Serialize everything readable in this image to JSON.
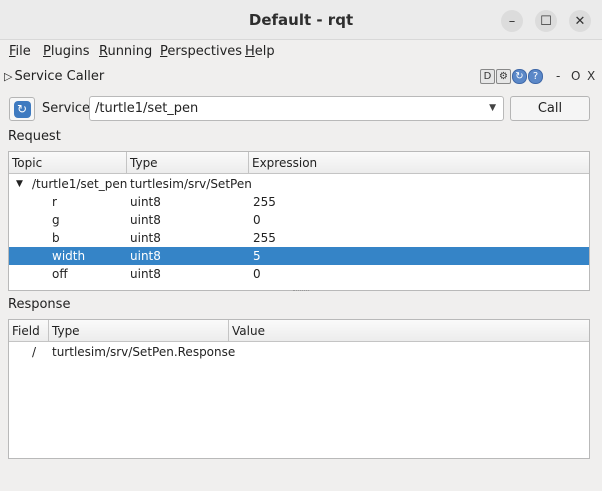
{
  "window": {
    "title": "Default - rqt"
  },
  "menu": [
    {
      "u": "F",
      "rest": "ile"
    },
    {
      "u": "P",
      "rest": "lugins"
    },
    {
      "u": "R",
      "rest": "unning"
    },
    {
      "u": "P",
      "rest": "erspectives"
    },
    {
      "u": "H",
      "rest": "elp"
    }
  ],
  "plugin": {
    "title": "Service Caller",
    "controls": {
      "d_label": "D",
      "min_label": "-",
      "restore_label": "O",
      "close_label": "X"
    }
  },
  "service": {
    "label": "Service",
    "selected": "/turtle1/set_pen",
    "call_label": "Call"
  },
  "request": {
    "label": "Request",
    "columns": [
      "Topic",
      "Type",
      "Expression"
    ],
    "root": {
      "topic": "/turtle1/set_pen",
      "type": "turtlesim/srv/SetPen",
      "expression": ""
    },
    "rows": [
      {
        "topic": "r",
        "type": "uint8",
        "expression": "255"
      },
      {
        "topic": "g",
        "type": "uint8",
        "expression": "0"
      },
      {
        "topic": "b",
        "type": "uint8",
        "expression": "255"
      },
      {
        "topic": "width",
        "type": "uint8",
        "expression": "5"
      },
      {
        "topic": "off",
        "type": "uint8",
        "expression": "0"
      }
    ],
    "selected_index": 3
  },
  "response": {
    "label": "Response",
    "columns": [
      "Field",
      "Type",
      "Value"
    ],
    "rows": [
      {
        "field": "/",
        "type": "turtlesim/srv/SetPen.Response",
        "value": ""
      }
    ]
  },
  "colors": {
    "selection": "#3584c7",
    "background": "#f0efee"
  }
}
